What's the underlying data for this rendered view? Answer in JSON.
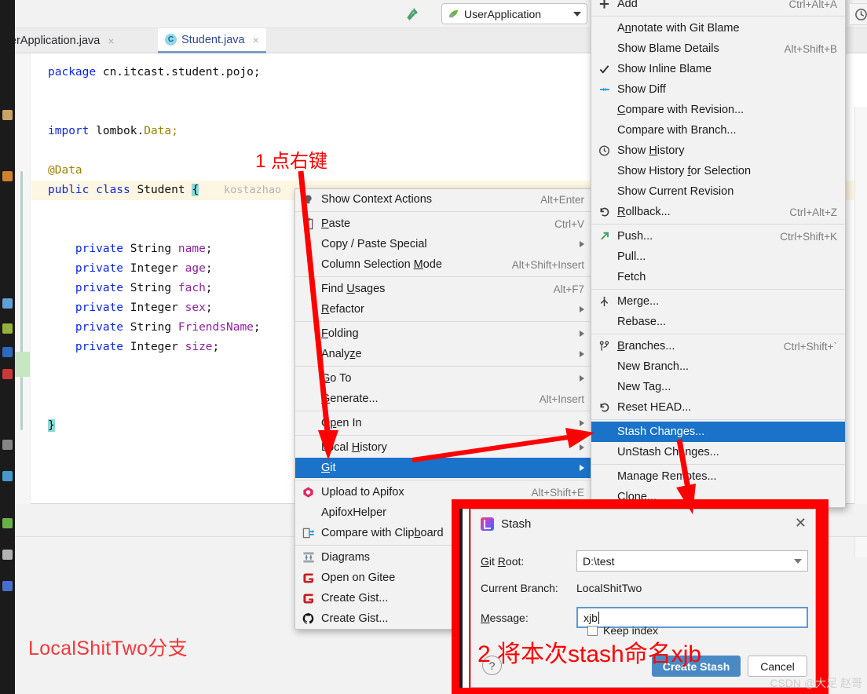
{
  "toolbar": {
    "build_icon": "hammer-icon",
    "run_config": "UserApplication",
    "clock_icon": "clock-icon"
  },
  "tabs": [
    {
      "label": "rderApplication.java",
      "active": false,
      "close": "×"
    },
    {
      "label": "Student.java",
      "active": true,
      "close": "×",
      "badge": "C"
    }
  ],
  "editor": {
    "blame": "kostazhao",
    "lines": [
      {
        "parts": [
          {
            "t": "package ",
            "c": "kw"
          },
          {
            "t": "cn.itcast.student.pojo;",
            "c": "ty"
          }
        ]
      },
      {
        "parts": []
      },
      {
        "parts": []
      },
      {
        "parts": [
          {
            "t": "import ",
            "c": "kw"
          },
          {
            "t": "lombok.",
            "c": "ty"
          },
          {
            "t": "Data;",
            "c": "an"
          }
        ]
      },
      {
        "parts": []
      },
      {
        "parts": [
          {
            "t": "@Data",
            "c": "an"
          }
        ]
      },
      {
        "parts": [
          {
            "t": "public ",
            "c": "kw"
          },
          {
            "t": "class ",
            "c": "kw"
          },
          {
            "t": "Student ",
            "c": "ty"
          },
          {
            "t": "{",
            "c": "cur"
          }
        ],
        "hl": true
      },
      {
        "parts": []
      },
      {
        "parts": []
      },
      {
        "parts": [
          {
            "t": "    private ",
            "c": "kw"
          },
          {
            "t": "String ",
            "c": "ty"
          },
          {
            "t": "name",
            "c": "fld"
          },
          {
            "t": ";",
            "c": "ty"
          }
        ]
      },
      {
        "parts": [
          {
            "t": "    private ",
            "c": "kw"
          },
          {
            "t": "Integer ",
            "c": "ty"
          },
          {
            "t": "age",
            "c": "fld"
          },
          {
            "t": ";",
            "c": "ty"
          }
        ]
      },
      {
        "parts": [
          {
            "t": "    private ",
            "c": "kw"
          },
          {
            "t": "String ",
            "c": "ty"
          },
          {
            "t": "fach",
            "c": "fld"
          },
          {
            "t": ";",
            "c": "ty"
          }
        ]
      },
      {
        "parts": [
          {
            "t": "    private ",
            "c": "kw"
          },
          {
            "t": "Integer ",
            "c": "ty"
          },
          {
            "t": "sex",
            "c": "fld"
          },
          {
            "t": ";",
            "c": "ty"
          }
        ]
      },
      {
        "parts": [
          {
            "t": "    private ",
            "c": "kw"
          },
          {
            "t": "String ",
            "c": "ty"
          },
          {
            "t": "FriendsName",
            "c": "fld"
          },
          {
            "t": ";",
            "c": "ty"
          }
        ]
      },
      {
        "parts": [
          {
            "t": "    private ",
            "c": "kw"
          },
          {
            "t": "Integer ",
            "c": "ty"
          },
          {
            "t": "size",
            "c": "fld"
          },
          {
            "t": ";",
            "c": "ty"
          }
        ]
      },
      {
        "parts": []
      },
      {
        "parts": []
      },
      {
        "parts": []
      },
      {
        "parts": [
          {
            "t": "}",
            "c": "cur"
          }
        ]
      }
    ]
  },
  "annotations": {
    "step1": "1 点右键",
    "step2": "2 将本次stash命名xjb",
    "branch_note": "LocalShitTwo分支",
    "watermark": "CSDN @大足 赵哥"
  },
  "context_menu": {
    "items": [
      {
        "label": "Show Context Actions",
        "accel": "Alt+Enter",
        "icon": "lightbulb-icon"
      },
      {
        "sep": true
      },
      {
        "label": "Paste",
        "accel": "Ctrl+V",
        "icon": "clipboard-icon",
        "mnemonic": "P"
      },
      {
        "label": "Copy / Paste Special",
        "submenu": true
      },
      {
        "label": "Column Selection Mode",
        "accel": "Alt+Shift+Insert",
        "mnemonic": "M"
      },
      {
        "sep": true
      },
      {
        "label": "Find Usages",
        "accel": "Alt+F7",
        "mnemonic": "U"
      },
      {
        "label": "Refactor",
        "submenu": true,
        "mnemonic": "R"
      },
      {
        "sep": true
      },
      {
        "label": "Folding",
        "submenu": true,
        "mnemonic": "F"
      },
      {
        "label": "Analyze",
        "submenu": true,
        "mnemonic": "z"
      },
      {
        "sep": true
      },
      {
        "label": "Go To",
        "submenu": true,
        "mnemonic": "G"
      },
      {
        "label": "Generate...",
        "accel": "Alt+Insert",
        "mnemonic": "G"
      },
      {
        "sep": true
      },
      {
        "label": "Open In",
        "submenu": true,
        "mnemonic": "p"
      },
      {
        "sep": true
      },
      {
        "label": "Local History",
        "submenu": true,
        "mnemonic": "H"
      },
      {
        "label": "Git",
        "submenu": true,
        "selected": true,
        "mnemonic": "G"
      },
      {
        "sep": true
      },
      {
        "label": "Upload to Apifox",
        "accel": "Alt+Shift+E",
        "icon": "apifox-icon"
      },
      {
        "label": "ApifoxHelper"
      },
      {
        "label": "Compare with Clipboard",
        "icon": "compare-clipboard-icon",
        "mnemonic": "b"
      },
      {
        "sep": true
      },
      {
        "label": "Diagrams",
        "icon": "diagrams-icon"
      },
      {
        "label": "Open on Gitee",
        "icon": "gitee-icon"
      },
      {
        "label": "Create Gist...",
        "icon": "gitee-icon"
      },
      {
        "label": "Create Gist...",
        "icon": "github-icon"
      }
    ]
  },
  "git_menu": {
    "items": [
      {
        "label": "Add",
        "accel": "Ctrl+Alt+A",
        "icon": "plus-icon"
      },
      {
        "sep": true
      },
      {
        "label": "Annotate with Git Blame",
        "mnemonic": "n"
      },
      {
        "label": "Show Blame Details",
        "accel": "Alt+Shift+B"
      },
      {
        "label": "Show Inline Blame",
        "icon": "check-icon"
      },
      {
        "label": "Show Diff",
        "icon": "diff-icon"
      },
      {
        "label": "Compare with Revision...",
        "mnemonic": "C"
      },
      {
        "label": "Compare with Branch..."
      },
      {
        "label": "Show History",
        "icon": "clock-icon",
        "mnemonic": "H"
      },
      {
        "label": "Show History for Selection",
        "mnemonic": "f"
      },
      {
        "label": "Show Current Revision"
      },
      {
        "label": "Rollback...",
        "accel": "Ctrl+Alt+Z",
        "icon": "rollback-icon",
        "mnemonic": "R"
      },
      {
        "sep": true
      },
      {
        "label": "Push...",
        "accel": "Ctrl+Shift+K",
        "icon": "push-icon"
      },
      {
        "label": "Pull..."
      },
      {
        "label": "Fetch"
      },
      {
        "sep": true
      },
      {
        "label": "Merge...",
        "icon": "merge-icon"
      },
      {
        "label": "Rebase..."
      },
      {
        "sep": true
      },
      {
        "label": "Branches...",
        "accel": "Ctrl+Shift+`",
        "icon": "branch-icon",
        "mnemonic": "B"
      },
      {
        "label": "New Branch..."
      },
      {
        "label": "New Tag..."
      },
      {
        "label": "Reset HEAD...",
        "icon": "rollback-icon"
      },
      {
        "sep": true
      },
      {
        "label": "Stash Changes...",
        "selected": true
      },
      {
        "label": "UnStash Changes..."
      },
      {
        "sep": true
      },
      {
        "label": "Manage Remotes..."
      },
      {
        "label": "Clone..."
      }
    ]
  },
  "stash_dialog": {
    "title": "Stash",
    "close_icon": "close-icon",
    "git_root_label": "Git Root:",
    "git_root_value": "D:\\test",
    "current_branch_label": "Current Branch:",
    "current_branch_value": "LocalShitTwo",
    "message_label": "Message:",
    "message_value": "xjb",
    "keep_index_label": "Keep index",
    "help_label": "?",
    "create_button": "Create Stash",
    "cancel_button": "Cancel"
  },
  "colors": {
    "accent_blue": "#1a73c8",
    "button_blue": "#4989c4",
    "annotation_red": "#fe0000",
    "keyword_blue": "#0c27e0",
    "field_purple": "#8e1f9e"
  }
}
